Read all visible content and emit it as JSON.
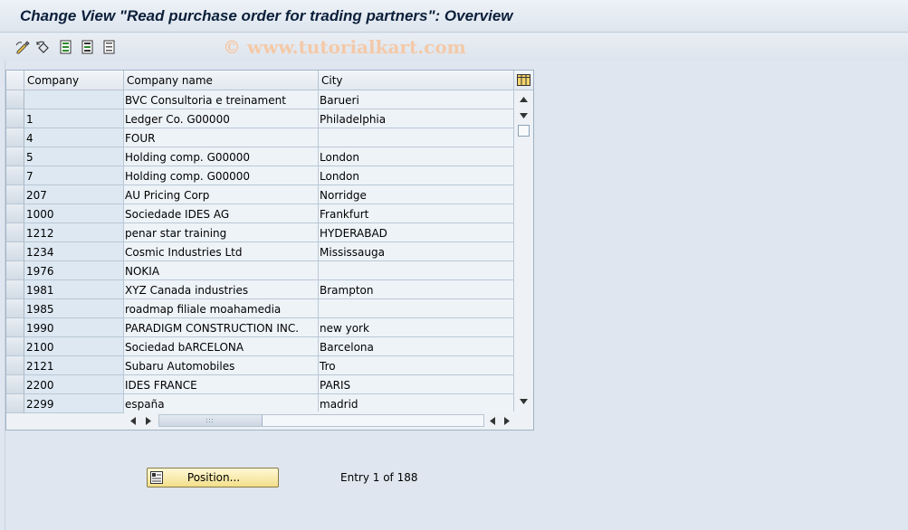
{
  "window": {
    "title": "Change View \"Read purchase order for trading partners\": Overview"
  },
  "watermark": "© www.tutorialkart.com",
  "toolbar": {
    "buttons": [
      {
        "name": "edit-icon"
      },
      {
        "name": "undo-icon"
      },
      {
        "name": "select-all-icon"
      },
      {
        "name": "select-block-icon"
      },
      {
        "name": "deselect-icon"
      }
    ]
  },
  "table": {
    "columns": [
      "Company",
      "Company name",
      "City"
    ],
    "rows": [
      {
        "company": "",
        "name": "BVC Consultoria e treinament",
        "city": "Barueri"
      },
      {
        "company": "1",
        "name": "Ledger Co. G00000",
        "city": "Philadelphia"
      },
      {
        "company": "4",
        "name": "FOUR",
        "city": ""
      },
      {
        "company": "5",
        "name": "Holding comp. G00000",
        "city": "London"
      },
      {
        "company": "7",
        "name": "Holding comp. G00000",
        "city": "London"
      },
      {
        "company": "207",
        "name": "AU Pricing Corp",
        "city": "Norridge"
      },
      {
        "company": "1000",
        "name": "Sociedade IDES AG",
        "city": "Frankfurt"
      },
      {
        "company": "1212",
        "name": "penar star training",
        "city": "HYDERABAD"
      },
      {
        "company": "1234",
        "name": "Cosmic Industries Ltd",
        "city": "Mississauga"
      },
      {
        "company": "1976",
        "name": "NOKIA",
        "city": ""
      },
      {
        "company": "1981",
        "name": "XYZ Canada industries",
        "city": "Brampton"
      },
      {
        "company": "1985",
        "name": "roadmap filiale moahamedia",
        "city": ""
      },
      {
        "company": "1990",
        "name": "PARADIGM CONSTRUCTION INC.",
        "city": "new york"
      },
      {
        "company": "2100",
        "name": "Sociedad bARCELONA",
        "city": "Barcelona"
      },
      {
        "company": "2121",
        "name": "Subaru Automobiles",
        "city": "Tro"
      },
      {
        "company": "2200",
        "name": "IDES FRANCE",
        "city": "PARIS"
      },
      {
        "company": "2299",
        "name": "españa",
        "city": "madrid"
      }
    ]
  },
  "footer": {
    "position_button": "Position...",
    "entry_text": "Entry 1 of 188"
  }
}
